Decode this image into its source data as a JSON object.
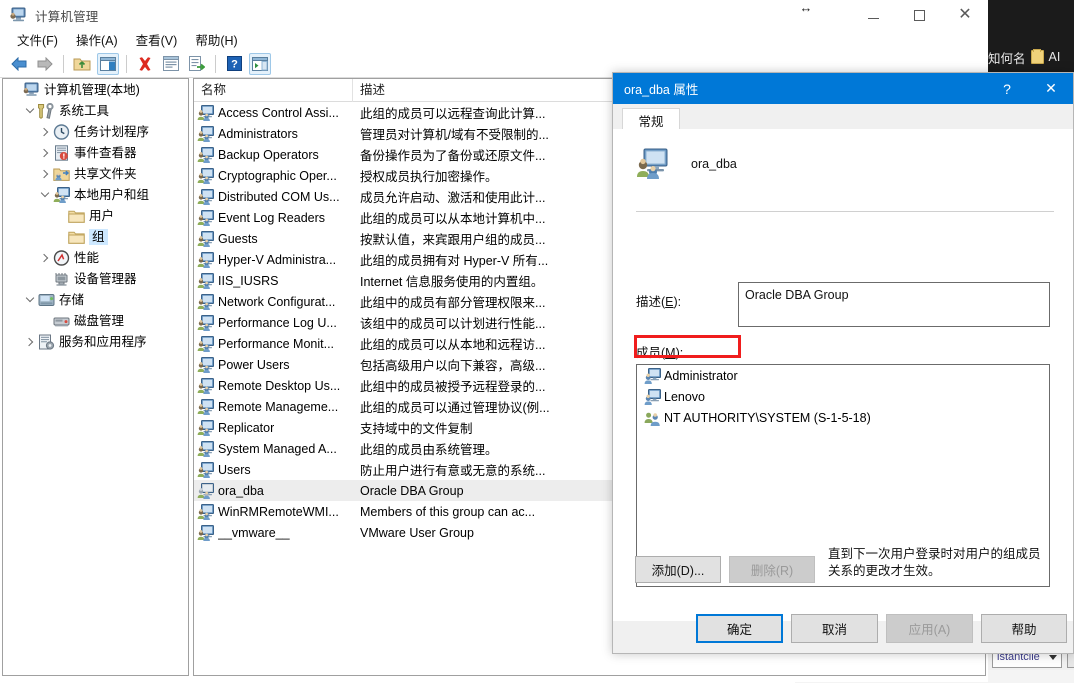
{
  "window": {
    "title": "计算机管理",
    "title_icon": "computer-management-icon",
    "controls": {
      "minimize": "–",
      "maximize": "□",
      "close": "✕"
    },
    "resize_cursor": "↔"
  },
  "menubar": {
    "items": [
      {
        "name": "file",
        "label": "文件(F)"
      },
      {
        "name": "action",
        "label": "操作(A)"
      },
      {
        "name": "view",
        "label": "查看(V)"
      },
      {
        "name": "help",
        "label": "帮助(H)"
      }
    ]
  },
  "toolbar": {
    "items": [
      {
        "name": "back-icon",
        "kind": "arrow-left"
      },
      {
        "name": "forward-icon",
        "kind": "arrow-right"
      },
      {
        "name": "separator-1",
        "kind": "sep"
      },
      {
        "name": "up-folder-icon",
        "kind": "folder-up"
      },
      {
        "name": "show-hide-tree-icon",
        "kind": "pane-toggle",
        "framed": true
      },
      {
        "name": "separator-2",
        "kind": "sep"
      },
      {
        "name": "delete-icon",
        "kind": "red-x"
      },
      {
        "name": "properties-icon",
        "kind": "props"
      },
      {
        "name": "export-list-icon",
        "kind": "export"
      },
      {
        "name": "separator-3",
        "kind": "sep"
      },
      {
        "name": "help-icon",
        "kind": "help"
      },
      {
        "name": "show-action-pane-icon",
        "kind": "action-pane",
        "framed": true
      }
    ]
  },
  "tree": {
    "items": [
      {
        "name": "computer-management-local",
        "label": "计算机管理(本地)",
        "indent": 0,
        "twisty": "none",
        "icon": "computer-icon",
        "selected": false
      },
      {
        "name": "system-tools",
        "label": "系统工具",
        "indent": 1,
        "twisty": "expanded",
        "icon": "tools-icon",
        "selected": false
      },
      {
        "name": "task-scheduler",
        "label": "任务计划程序",
        "indent": 2,
        "twisty": "collapsed",
        "icon": "clock-icon",
        "selected": false
      },
      {
        "name": "event-viewer",
        "label": "事件查看器",
        "indent": 2,
        "twisty": "collapsed",
        "icon": "event-log-icon",
        "selected": false
      },
      {
        "name": "shared-folders",
        "label": "共享文件夹",
        "indent": 2,
        "twisty": "collapsed",
        "icon": "shared-folder-icon",
        "selected": false
      },
      {
        "name": "local-users-and-groups",
        "label": "本地用户和组",
        "indent": 2,
        "twisty": "expanded",
        "icon": "users-groups-icon",
        "selected": false
      },
      {
        "name": "users-folder",
        "label": "用户",
        "indent": 3,
        "twisty": "none",
        "icon": "folder-icon",
        "selected": false
      },
      {
        "name": "groups-folder",
        "label": "组",
        "indent": 3,
        "twisty": "none",
        "icon": "folder-icon",
        "selected": true
      },
      {
        "name": "performance",
        "label": "性能",
        "indent": 2,
        "twisty": "collapsed",
        "icon": "performance-icon",
        "selected": false
      },
      {
        "name": "device-manager",
        "label": "设备管理器",
        "indent": 2,
        "twisty": "none",
        "icon": "device-manager-icon",
        "selected": false
      },
      {
        "name": "storage",
        "label": "存储",
        "indent": 1,
        "twisty": "expanded",
        "icon": "storage-icon",
        "selected": false
      },
      {
        "name": "disk-management",
        "label": "磁盘管理",
        "indent": 2,
        "twisty": "none",
        "icon": "disk-icon",
        "selected": false
      },
      {
        "name": "services-and-applications",
        "label": "服务和应用程序",
        "indent": 1,
        "twisty": "collapsed",
        "icon": "services-icon",
        "selected": false
      }
    ]
  },
  "list": {
    "columns": [
      {
        "name": "column-name",
        "label": "名称"
      },
      {
        "name": "column-description",
        "label": "描述"
      },
      {
        "name": "column-extra",
        "label": ""
      }
    ],
    "rows": [
      {
        "name": "Access Control Assi...",
        "description": "此组的成员可以远程查询此计算...",
        "icon": "group-icon",
        "selected": false
      },
      {
        "name": "Administrators",
        "description": "管理员对计算机/域有不受限制的...",
        "icon": "group-icon",
        "selected": false
      },
      {
        "name": "Backup Operators",
        "description": "备份操作员为了备份或还原文件...",
        "icon": "group-icon",
        "selected": false
      },
      {
        "name": "Cryptographic Oper...",
        "description": "授权成员执行加密操作。",
        "icon": "group-icon",
        "selected": false
      },
      {
        "name": "Distributed COM Us...",
        "description": "成员允许启动、激活和使用此计...",
        "icon": "group-icon",
        "selected": false
      },
      {
        "name": "Event Log Readers",
        "description": "此组的成员可以从本地计算机中...",
        "icon": "group-icon",
        "selected": false
      },
      {
        "name": "Guests",
        "description": "按默认值，来宾跟用户组的成员...",
        "icon": "group-icon",
        "selected": false
      },
      {
        "name": "Hyper-V Administra...",
        "description": "此组的成员拥有对 Hyper-V 所有...",
        "icon": "group-icon",
        "selected": false
      },
      {
        "name": "IIS_IUSRS",
        "description": "Internet 信息服务使用的内置组。",
        "icon": "group-icon",
        "selected": false
      },
      {
        "name": "Network Configurat...",
        "description": "此组中的成员有部分管理权限来...",
        "icon": "group-icon",
        "selected": false
      },
      {
        "name": "Performance Log U...",
        "description": "该组中的成员可以计划进行性能...",
        "icon": "group-icon",
        "selected": false
      },
      {
        "name": "Performance Monit...",
        "description": "此组的成员可以从本地和远程访...",
        "icon": "group-icon",
        "selected": false
      },
      {
        "name": "Power Users",
        "description": "包括高级用户以向下兼容，高级...",
        "icon": "group-icon",
        "selected": false
      },
      {
        "name": "Remote Desktop Us...",
        "description": "此组中的成员被授予远程登录的...",
        "icon": "group-icon",
        "selected": false
      },
      {
        "name": "Remote Manageme...",
        "description": "此组的成员可以通过管理协议(例...",
        "icon": "group-icon",
        "selected": false
      },
      {
        "name": "Replicator",
        "description": "支持域中的文件复制",
        "icon": "group-icon",
        "selected": false
      },
      {
        "name": "System Managed A...",
        "description": "此组的成员由系统管理。",
        "icon": "group-icon",
        "selected": false
      },
      {
        "name": "Users",
        "description": "防止用户进行有意或无意的系统...",
        "icon": "group-icon",
        "selected": false
      },
      {
        "name": "ora_dba",
        "description": "Oracle DBA Group",
        "icon": "group-icon-alt",
        "selected": true
      },
      {
        "name": "WinRMRemoteWMI...",
        "description": "Members of this group can ac...",
        "icon": "group-icon",
        "selected": false
      },
      {
        "name": "__vmware__",
        "description": "VMware User Group",
        "icon": "group-icon",
        "selected": false
      }
    ]
  },
  "dialog": {
    "title": "ora_dba 属性",
    "help_button": "?",
    "close_button": "✕",
    "tab": {
      "name": "general",
      "label": "常规"
    },
    "group_icon": "group-properties-icon",
    "group_name": "ora_dba",
    "description_label": "描述(E)",
    "description_value": "Oracle DBA Group",
    "members_label": "成员(M)",
    "members": [
      {
        "name": "Administrator",
        "icon": "user-icon",
        "highlighted": false
      },
      {
        "name": "Lenovo",
        "icon": "user-icon",
        "highlighted": true
      },
      {
        "name": "NT AUTHORITY\\SYSTEM (S-1-5-18)",
        "icon": "system-user-icon",
        "highlighted": false
      }
    ],
    "add_button": "添加(D)...",
    "remove_button": "删除(R)",
    "hint": "直到下一次用户登录时对用户的组成员关系的更改才生效。",
    "ok_button": "确定",
    "cancel_button": "取消",
    "apply_button": "应用(A)",
    "help_footer_button": "帮助",
    "highlight_color": "#f01d1d",
    "accent_color": "#0078d7"
  },
  "background": {
    "dark_label": "知何名",
    "dark_label_suffix": "AI",
    "lower_window_combo": "istantclie",
    "lower_window_button": "..."
  }
}
